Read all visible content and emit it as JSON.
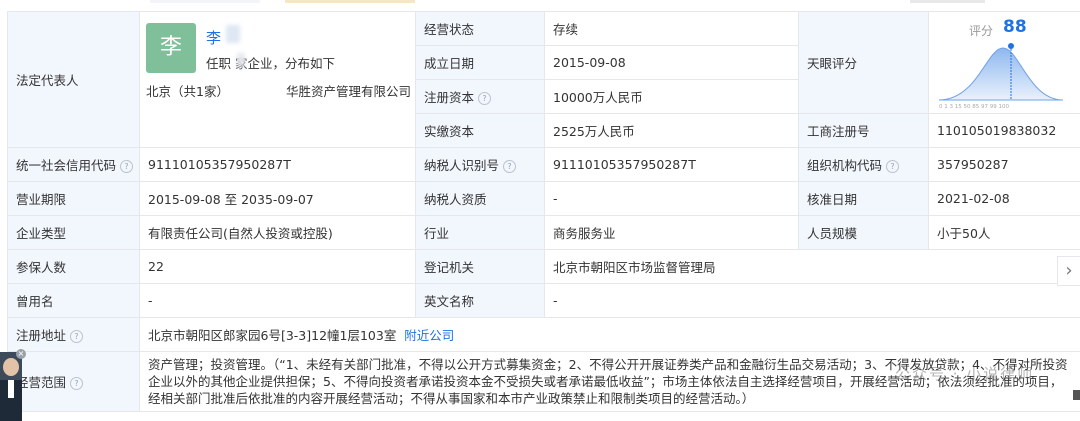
{
  "legal_rep": {
    "label": "法定代表人",
    "avatar_char": "李",
    "name": "李",
    "desc": "任职 家企业，分布如下",
    "city": "北京（共1家）",
    "company": "华胜资产管理有限公司"
  },
  "score": {
    "label": "评分",
    "value": "88",
    "cell_label": "天眼评分",
    "axis": "0 1 3 15 50 85 97 99 100"
  },
  "rows": {
    "status": {
      "label": "经营状态",
      "value": "存续"
    },
    "founded": {
      "label": "成立日期",
      "value": "2015-09-08"
    },
    "reg_capital": {
      "label": "注册资本",
      "value": "10000万人民币"
    },
    "paid_capital": {
      "label": "实缴资本",
      "value": "2525万人民币"
    },
    "reg_no": {
      "label": "工商注册号",
      "value": "110105019838032"
    },
    "credit_code": {
      "label": "统一社会信用代码",
      "value": "91110105357950287T"
    },
    "taxpayer_id": {
      "label": "纳税人识别号",
      "value": "91110105357950287T"
    },
    "org_code": {
      "label": "组织机构代码",
      "value": "357950287"
    },
    "term": {
      "label": "营业期限",
      "value": "2015-09-08  至 2035-09-07"
    },
    "taxpayer_qual": {
      "label": "纳税人资质",
      "value": "-"
    },
    "approve_date": {
      "label": "核准日期",
      "value": "2021-02-08"
    },
    "ent_type": {
      "label": "企业类型",
      "value": "有限责任公司(自然人投资或控股)"
    },
    "industry": {
      "label": "行业",
      "value": "商务服务业"
    },
    "staff": {
      "label": "人员规模",
      "value": "小于50人"
    },
    "insured": {
      "label": "参保人数",
      "value": "22"
    },
    "authority": {
      "label": "登记机关",
      "value": "北京市朝阳区市场监督管理局"
    },
    "former_name": {
      "label": "曾用名",
      "value": "-"
    },
    "en_name": {
      "label": "英文名称",
      "value": "-"
    },
    "address": {
      "label": "注册地址",
      "value": "北京市朝阳区郎家园6号[3-3]12幢1层103室",
      "link": "附近公司"
    },
    "scope": {
      "label": "经营范围",
      "value": "资产管理；投资管理。（“1、未经有关部门批准，不得以公开方式募集资金；2、不得公开开展证券类产品和金融衍生品交易活动；3、不得发放贷款；4、不得对所投资企业以外的其他企业提供担保；5、不得向投资者承诺投资本金不受损失或者承诺最低收益”；市场主体依法自主选择经营项目，开展经营活动；依法须经批准的项目，经相关部门批准后依批准的内容开展经营活动；不得从事国家和本市产业政策禁止和限制类项目的经营活动。）"
    }
  },
  "watermark": "公众号 · 小说律师",
  "icons": {
    "help": "help-circle-icon",
    "next": "chevron-right-icon",
    "close": "close-icon"
  },
  "colors": {
    "label_bg": "#f2f6fd",
    "accent": "#1e72e3",
    "avatar_bg": "#7fbf9a",
    "border": "#e5e7ec"
  }
}
